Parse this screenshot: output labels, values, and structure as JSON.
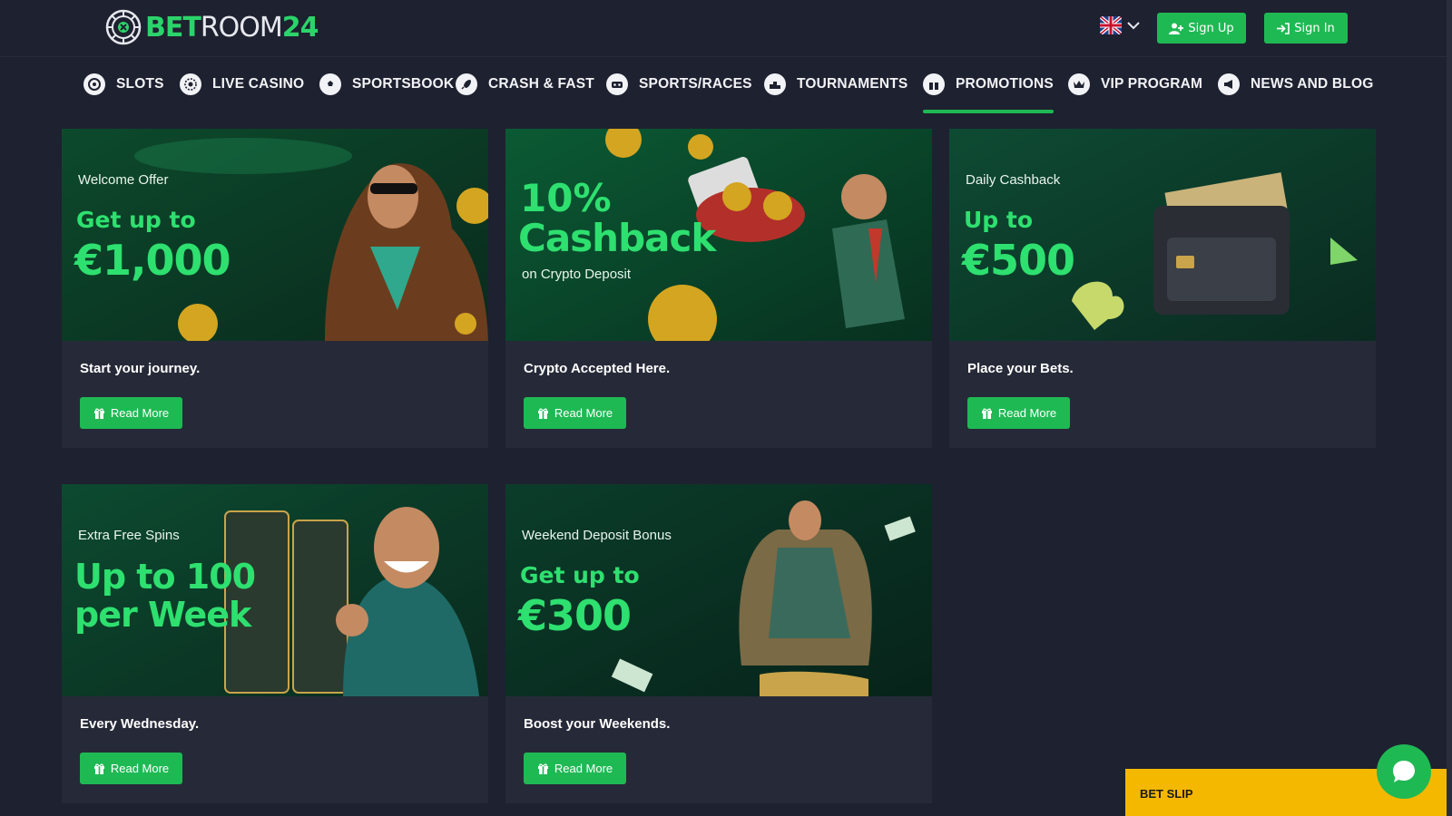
{
  "header": {
    "logo_prefix": "BET",
    "logo_main": "ROOM",
    "logo_suffix": "24",
    "language": "en-GB",
    "signup_label": "Sign Up",
    "signin_label": "Sign In",
    "signup_icon": "user-plus-icon",
    "signin_icon": "sign-in-icon"
  },
  "nav": {
    "items": [
      {
        "label": "SLOTS",
        "icon": "slots-icon"
      },
      {
        "label": "LIVE CASINO",
        "icon": "roulette-icon"
      },
      {
        "label": "SPORTSBOOK",
        "icon": "football-icon"
      },
      {
        "label": "CRASH & FAST",
        "icon": "rocket-icon"
      },
      {
        "label": "SPORTS/RACES",
        "icon": "vr-icon"
      },
      {
        "label": "TOURNAMENTS",
        "icon": "podium-icon"
      },
      {
        "label": "PROMOTIONS",
        "icon": "gift-icon",
        "active": true
      },
      {
        "label": "VIP PROGRAM",
        "icon": "crown-icon"
      },
      {
        "label": "NEWS AND BLOG",
        "icon": "megaphone-icon"
      }
    ]
  },
  "promos": [
    {
      "subtitle": "Welcome Offer",
      "line1": "Get up to",
      "big": "€1,000",
      "tagline": "Start your journey.",
      "button": "Read More"
    },
    {
      "subtitle": "",
      "line1": "10%",
      "big": "Cashback",
      "sub2": "on Crypto Deposit",
      "tagline": "Crypto Accepted Here.",
      "button": "Read More"
    },
    {
      "subtitle": "Daily Cashback",
      "line1": "Up to",
      "big": "€500",
      "tagline": "Place your Bets.",
      "button": "Read More"
    },
    {
      "subtitle": "Extra Free Spins",
      "line1": "Up to 100",
      "big": "per Week",
      "tagline": "Every Wednesday.",
      "button": "Read More"
    },
    {
      "subtitle": "Weekend Deposit Bonus",
      "line1": "Get up to",
      "big": "€300",
      "tagline": "Boost your Weekends.",
      "button": "Read More"
    }
  ],
  "betslip": {
    "label": "BET SLIP"
  },
  "colors": {
    "accent": "#1fb954",
    "background": "#1e2130",
    "card": "#262a38",
    "betslip": "#f5b800"
  }
}
